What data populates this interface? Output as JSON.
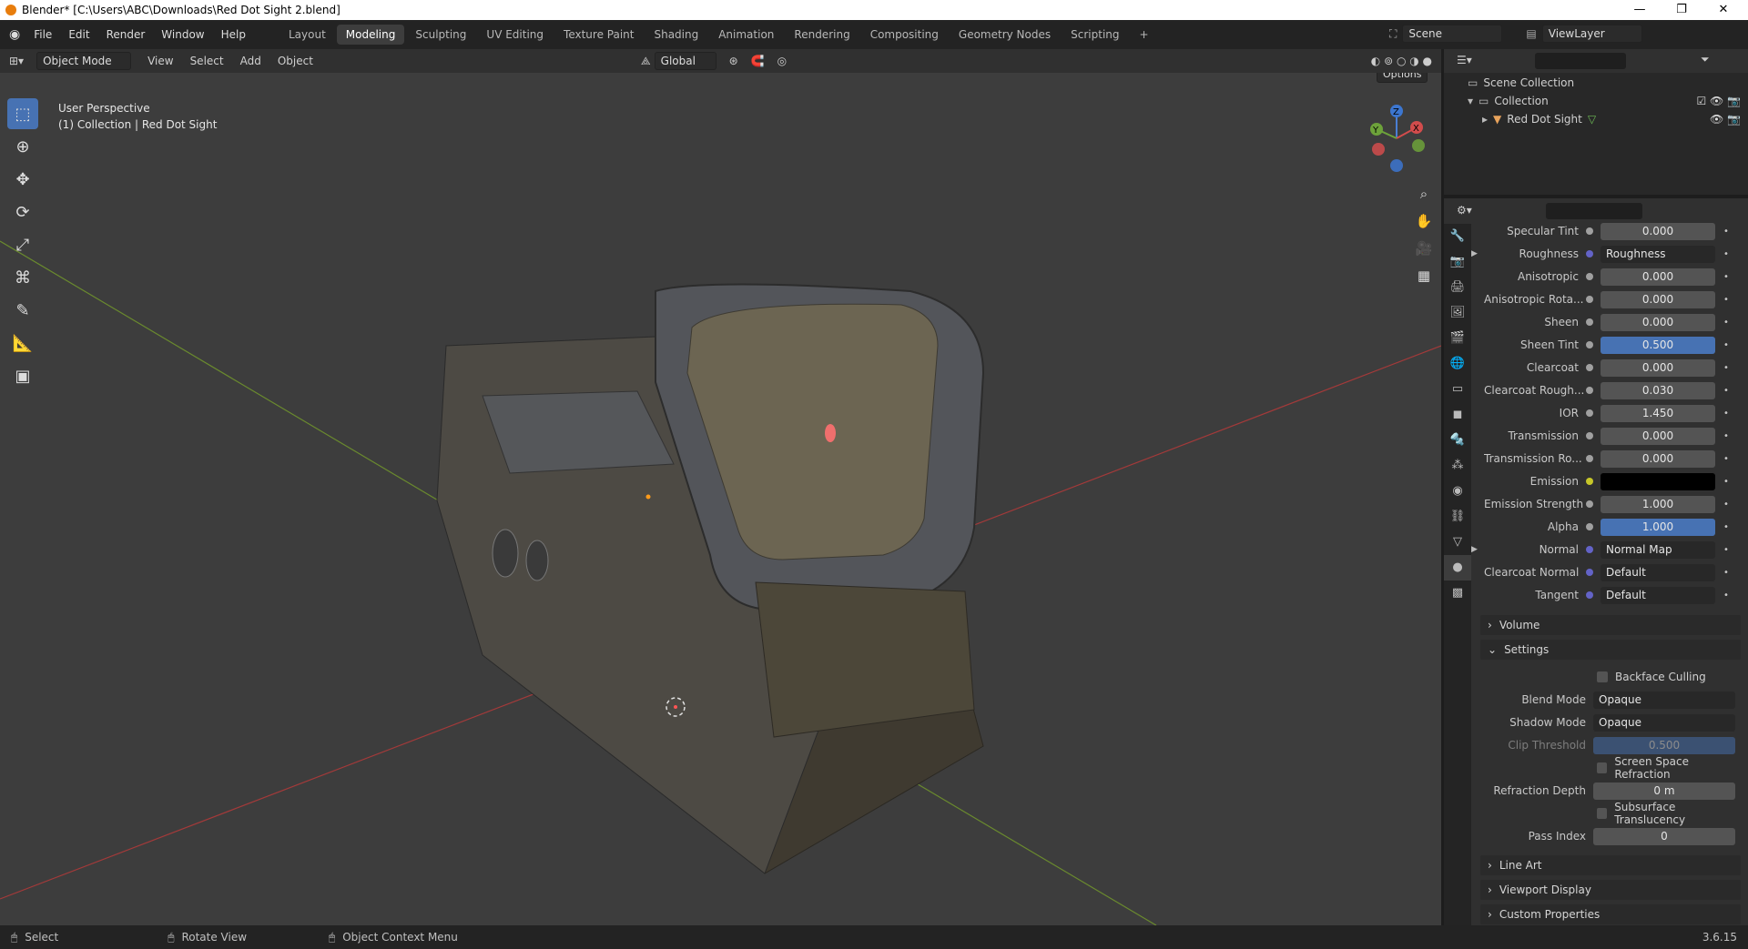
{
  "window": {
    "title": "Blender* [C:\\Users\\ABC\\Downloads\\Red Dot Sight 2.blend]"
  },
  "menu": [
    "File",
    "Edit",
    "Render",
    "Window",
    "Help"
  ],
  "workspaces": [
    "Layout",
    "Modeling",
    "Sculpting",
    "UV Editing",
    "Texture Paint",
    "Shading",
    "Animation",
    "Rendering",
    "Compositing",
    "Geometry Nodes",
    "Scripting"
  ],
  "active_workspace": "Modeling",
  "scene": "Scene",
  "view_layer": "ViewLayer",
  "header": {
    "mode": "Object Mode",
    "view": "View",
    "select": "Select",
    "add": "Add",
    "object": "Object",
    "orientation": "Global",
    "options": "Options"
  },
  "viewport": {
    "perspective": "User Perspective",
    "collection_info": "(1) Collection | Red Dot Sight"
  },
  "outliner": {
    "scene_collection": "Scene Collection",
    "collection": "Collection",
    "object": "Red Dot Sight"
  },
  "properties": [
    {
      "label": "Specular Tint",
      "value": "0.000",
      "type": "num"
    },
    {
      "label": "Roughness",
      "value": "Roughness",
      "type": "link",
      "expand": true
    },
    {
      "label": "Anisotropic",
      "value": "0.000",
      "type": "num"
    },
    {
      "label": "Anisotropic Rota...",
      "value": "0.000",
      "type": "num"
    },
    {
      "label": "Sheen",
      "value": "0.000",
      "type": "num"
    },
    {
      "label": "Sheen Tint",
      "value": "0.500",
      "type": "blue"
    },
    {
      "label": "Clearcoat",
      "value": "0.000",
      "type": "num"
    },
    {
      "label": "Clearcoat Rough...",
      "value": "0.030",
      "type": "num"
    },
    {
      "label": "IOR",
      "value": "1.450",
      "type": "num"
    },
    {
      "label": "Transmission",
      "value": "0.000",
      "type": "num"
    },
    {
      "label": "Transmission Ro...",
      "value": "0.000",
      "type": "num"
    },
    {
      "label": "Emission",
      "value": "",
      "type": "black"
    },
    {
      "label": "Emission Strength",
      "value": "1.000",
      "type": "num"
    },
    {
      "label": "Alpha",
      "value": "1.000",
      "type": "blue"
    },
    {
      "label": "Normal",
      "value": "Normal Map",
      "type": "link",
      "expand": true
    },
    {
      "label": "Clearcoat Normal",
      "value": "Default",
      "type": "link"
    },
    {
      "label": "Tangent",
      "value": "Default",
      "type": "link"
    }
  ],
  "sections": {
    "volume": "Volume",
    "settings": "Settings",
    "line_art": "Line Art",
    "viewport_display": "Viewport Display",
    "custom_properties": "Custom Properties"
  },
  "settings": {
    "backface_culling": "Backface Culling",
    "blend_mode_label": "Blend Mode",
    "blend_mode": "Opaque",
    "shadow_mode_label": "Shadow Mode",
    "shadow_mode": "Opaque",
    "clip_threshold_label": "Clip Threshold",
    "clip_threshold": "0.500",
    "ssr": "Screen Space Refraction",
    "refraction_depth_label": "Refraction Depth",
    "refraction_depth": "0 m",
    "sss": "Subsurface Translucency",
    "pass_index_label": "Pass Index",
    "pass_index": "0"
  },
  "status": {
    "select": "Select",
    "rotate": "Rotate View",
    "context": "Object Context Menu",
    "version": "3.6.15"
  },
  "colors": {
    "accent": "#4772b3",
    "background": "#3d3d3d",
    "panel": "#303030"
  }
}
